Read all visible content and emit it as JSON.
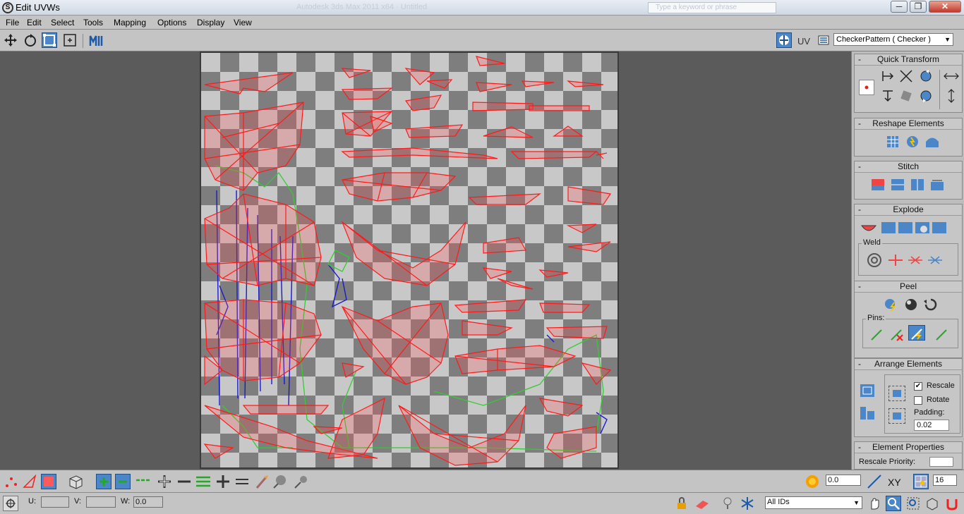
{
  "window": {
    "title": "Edit UVWs",
    "background_caption": "Autodesk 3ds Max 2011 x64 · Untitled",
    "search_placeholder": "Type a keyword or phrase",
    "minimize": "─",
    "maximize": "❐",
    "close": "✕"
  },
  "menu": [
    "File",
    "Edit",
    "Select",
    "Tools",
    "Mapping",
    "Options",
    "Display",
    "View"
  ],
  "toolbar": {
    "uv_label": "UV",
    "texture_dropdown": "CheckerPattern  ( Checker )"
  },
  "panel": {
    "quick_transform": "Quick Transform",
    "reshape_elements": "Reshape Elements",
    "stitch": "Stitch",
    "explode": "Explode",
    "weld": "Weld",
    "peel": "Peel",
    "pins": "Pins:",
    "arrange_elements": "Arrange Elements",
    "rescale": "Rescale",
    "rotate": "Rotate",
    "padding_label": "Padding:",
    "padding_value": "0.02",
    "element_properties": "Element Properties",
    "rescale_priority": "Rescale Priority:",
    "collapse": "-"
  },
  "bottom": {
    "soft_value": "0.0",
    "xy_label": "XY",
    "grid_value": "16",
    "u_label": "U:",
    "v_label": "V:",
    "w_label": "W:",
    "w_value": "0.0",
    "ids_dropdown": "All IDs"
  },
  "colors": {
    "wire": "#ff1a1a",
    "seam_green": "#33cc33",
    "seam_blue": "#1a1acc",
    "active_blue": "#4a86c8"
  }
}
